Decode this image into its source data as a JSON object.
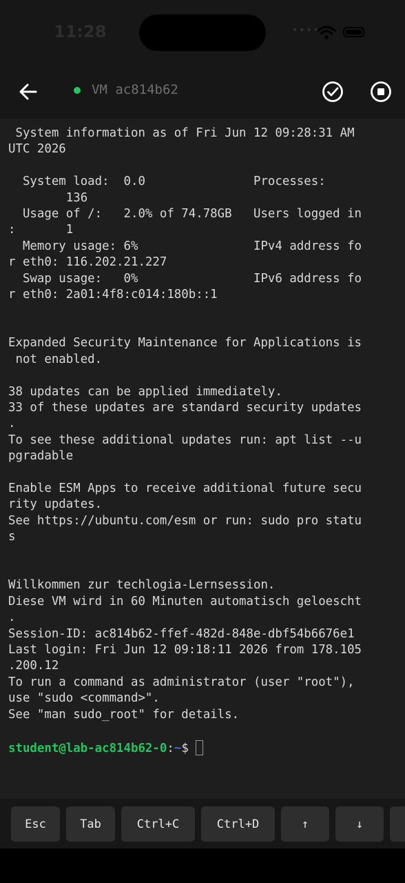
{
  "status_bar": {
    "time": "11:28"
  },
  "header": {
    "title": "VM ac814b62",
    "status_color": "#22c55e"
  },
  "terminal": {
    "output": " System information as of Fri Jun 12 09:28:31 AM\nUTC 2026\n\n  System load:  0.0               Processes:\n        136\n  Usage of /:   2.0% of 74.78GB   Users logged in\n:       1\n  Memory usage: 6%                IPv4 address fo\nr eth0: 116.202.21.227\n  Swap usage:   0%                IPv6 address fo\nr eth0: 2a01:4f8:c014:180b::1\n\n\nExpanded Security Maintenance for Applications is\n not enabled.\n\n38 updates can be applied immediately.\n33 of these updates are standard security updates\n.\nTo see these additional updates run: apt list --u\npgradable\n\nEnable ESM Apps to receive additional future secu\nrity updates.\nSee https://ubuntu.com/esm or run: sudo pro statu\ns\n\n\nWillkommen zur techlogia-Lernsession.\nDiese VM wird in 60 Minuten automatisch geloescht\n.\nSession-ID: ac814b62-ffef-482d-848e-dbf54b6676e1\nLast login: Fri Jun 12 09:18:11 2026 from 178.105\n.200.12\nTo run a command as administrator (user \"root\"),\nuse \"sudo <command>\".\nSee \"man sudo_root\" for details.",
    "prompt": {
      "user_host": "student@lab-ac814b62-0",
      "colon": ":",
      "path": "~",
      "symbol": "$"
    }
  },
  "keybar": {
    "keys": [
      "Esc",
      "Tab",
      "Ctrl+C",
      "Ctrl+D",
      "↑",
      "↓"
    ]
  },
  "icons": {
    "back": "arrow-left-icon",
    "check": "check-circle-icon",
    "stop": "stop-circle-icon"
  }
}
